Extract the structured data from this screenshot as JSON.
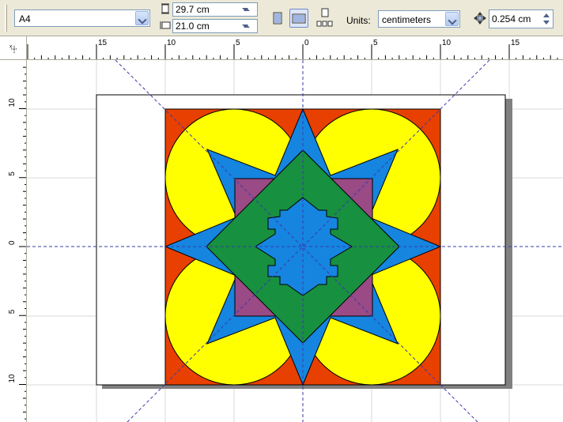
{
  "propbar": {
    "page_size": "A4",
    "page_height": "29.7 cm",
    "page_width": "21.0 cm",
    "units_label": "Units:",
    "units_value": "centimeters",
    "nudge_value": "0.254 cm"
  },
  "rulers": {
    "horizontal_labels": [
      "15",
      "10",
      "5",
      "0",
      "5",
      "10",
      "15"
    ],
    "vertical_labels": [
      "10",
      "5",
      "0",
      "5",
      "10"
    ]
  },
  "icons": {
    "portrait": "portrait-page-icon",
    "landscape": "landscape-page-icon",
    "layout": "page-layout-icon",
    "nudge": "nudge-icon",
    "page_height": "page-height-icon",
    "page_width": "page-width-icon"
  },
  "colors": {
    "background_square": "#E84000",
    "circles": "#FFFF00",
    "star": "#1585E0",
    "purple_square": "#9A4A84",
    "green_diamond": "#17903F",
    "page_shadow": "#808080",
    "guidelines": "#3A3AAA"
  }
}
